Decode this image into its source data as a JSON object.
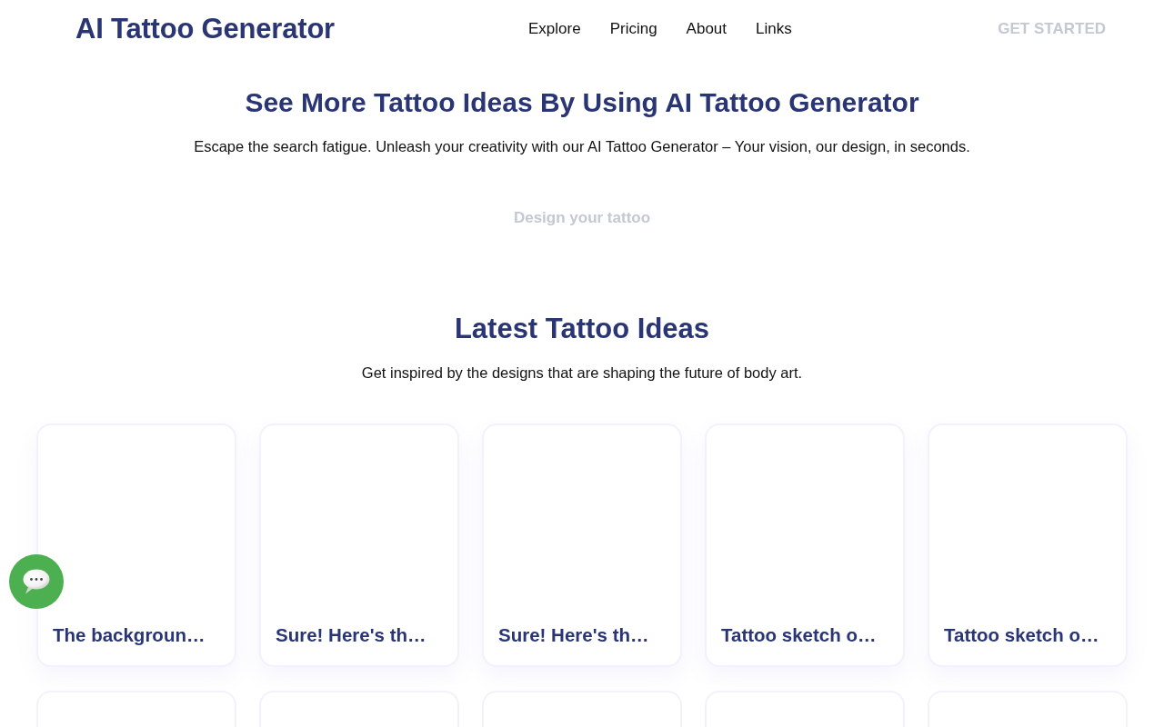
{
  "header": {
    "logo": "AI Tattoo Generator",
    "nav": [
      "Explore",
      "Pricing",
      "About",
      "Links"
    ],
    "cta": "GET STARTED"
  },
  "hero": {
    "title": "See More Tattoo Ideas By Using AI Tattoo Generator",
    "subtitle": "Escape the search fatigue. Unleash your creativity with our AI Tattoo Generator – Your vision, our design, in seconds.",
    "button": "Design your tattoo"
  },
  "latest": {
    "title": "Latest Tattoo Ideas",
    "subtitle": "Get inspired by the designs that are shaping the future of body art.",
    "cards": [
      {
        "kind": "idea",
        "title": "The backgroun…"
      },
      {
        "kind": "idea",
        "title": "Sure! Here's th…"
      },
      {
        "kind": "idea",
        "title": "Sure! Here's th…"
      },
      {
        "kind": "idea",
        "title": "Tattoo sketch o…"
      },
      {
        "kind": "idea",
        "title": "Tattoo sketch o…"
      },
      {
        "kind": "cut-off"
      },
      {
        "kind": "cut-off"
      },
      {
        "kind": "cut-off"
      },
      {
        "kind": "cut-off"
      },
      {
        "kind": "cut-off"
      }
    ]
  }
}
